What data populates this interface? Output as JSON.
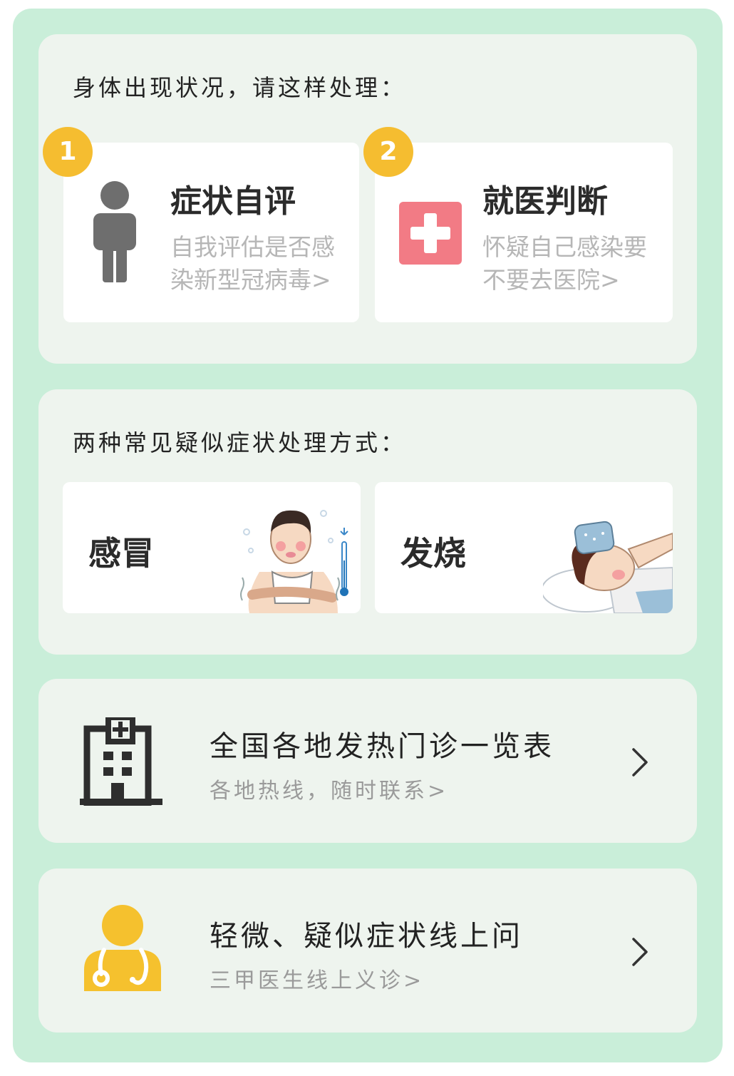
{
  "section1": {
    "title": "身体出现状况，请这样处理：",
    "cards": [
      {
        "badge": "1",
        "title": "症状自评",
        "desc": "自我评估是否感染新型冠病毒>",
        "icon": "person-icon"
      },
      {
        "badge": "2",
        "title": "就医判断",
        "desc": "怀疑自己感染要不要去医院>",
        "icon": "medical-cross-icon"
      }
    ]
  },
  "section2": {
    "title": "两种常见疑似症状处理方式：",
    "cards": [
      {
        "title": "感冒",
        "image": "cold-shivering-person-illustration"
      },
      {
        "title": "发烧",
        "image": "fever-person-ice-pack-illustration"
      }
    ]
  },
  "rows": [
    {
      "title": "全国各地发热门诊一览表",
      "subtitle": "各地热线，随时联系>",
      "icon": "hospital-building-icon"
    },
    {
      "title": "轻微、疑似症状线上问",
      "subtitle": "三甲医生线上义诊>",
      "icon": "doctor-icon"
    }
  ],
  "colors": {
    "background": "#c9eed9",
    "panel": "#eef4ee",
    "badge": "#f5bd30",
    "cross": "#f27b85",
    "doctor": "#f5c12e"
  }
}
